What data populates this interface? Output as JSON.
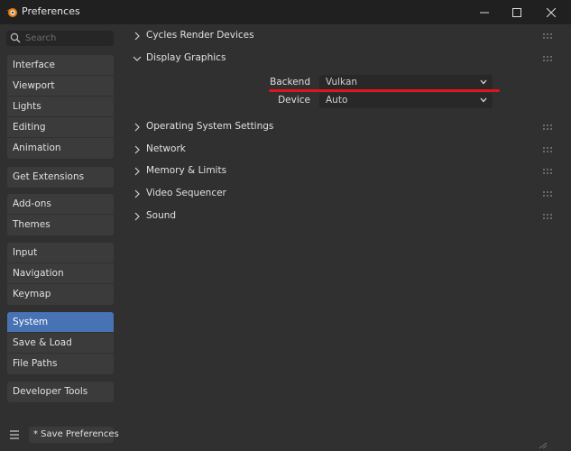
{
  "window": {
    "title": "Preferences",
    "icon": "blender-logo-icon"
  },
  "search": {
    "placeholder": "Search",
    "value": ""
  },
  "sidebar": {
    "groups": [
      {
        "items": [
          {
            "label": "Interface"
          },
          {
            "label": "Viewport"
          },
          {
            "label": "Lights"
          },
          {
            "label": "Editing"
          },
          {
            "label": "Animation"
          }
        ]
      },
      {
        "items": [
          {
            "label": "Get Extensions"
          }
        ]
      },
      {
        "items": [
          {
            "label": "Add-ons"
          },
          {
            "label": "Themes"
          }
        ]
      },
      {
        "items": [
          {
            "label": "Input"
          },
          {
            "label": "Navigation"
          },
          {
            "label": "Keymap"
          }
        ]
      },
      {
        "items": [
          {
            "label": "System",
            "active": true
          },
          {
            "label": "Save & Load"
          },
          {
            "label": "File Paths"
          }
        ]
      },
      {
        "items": [
          {
            "label": "Developer Tools"
          }
        ]
      }
    ],
    "save_preferences_label": "* Save Preferences"
  },
  "main": {
    "sections": [
      {
        "label": "Cycles Render Devices",
        "expanded": false
      },
      {
        "label": "Display Graphics",
        "expanded": true
      },
      {
        "label": "Operating System Settings",
        "expanded": false
      },
      {
        "label": "Network",
        "expanded": false
      },
      {
        "label": "Memory & Limits",
        "expanded": false
      },
      {
        "label": "Video Sequencer",
        "expanded": false
      },
      {
        "label": "Sound",
        "expanded": false
      }
    ],
    "display_graphics": {
      "backend_label": "Backend",
      "backend_value": "Vulkan",
      "device_label": "Device",
      "device_value": "Auto"
    }
  },
  "colors": {
    "accent": "#4772b3",
    "highlight_underline": "#e0141e",
    "background": "#303030",
    "titlebar": "#202020"
  }
}
